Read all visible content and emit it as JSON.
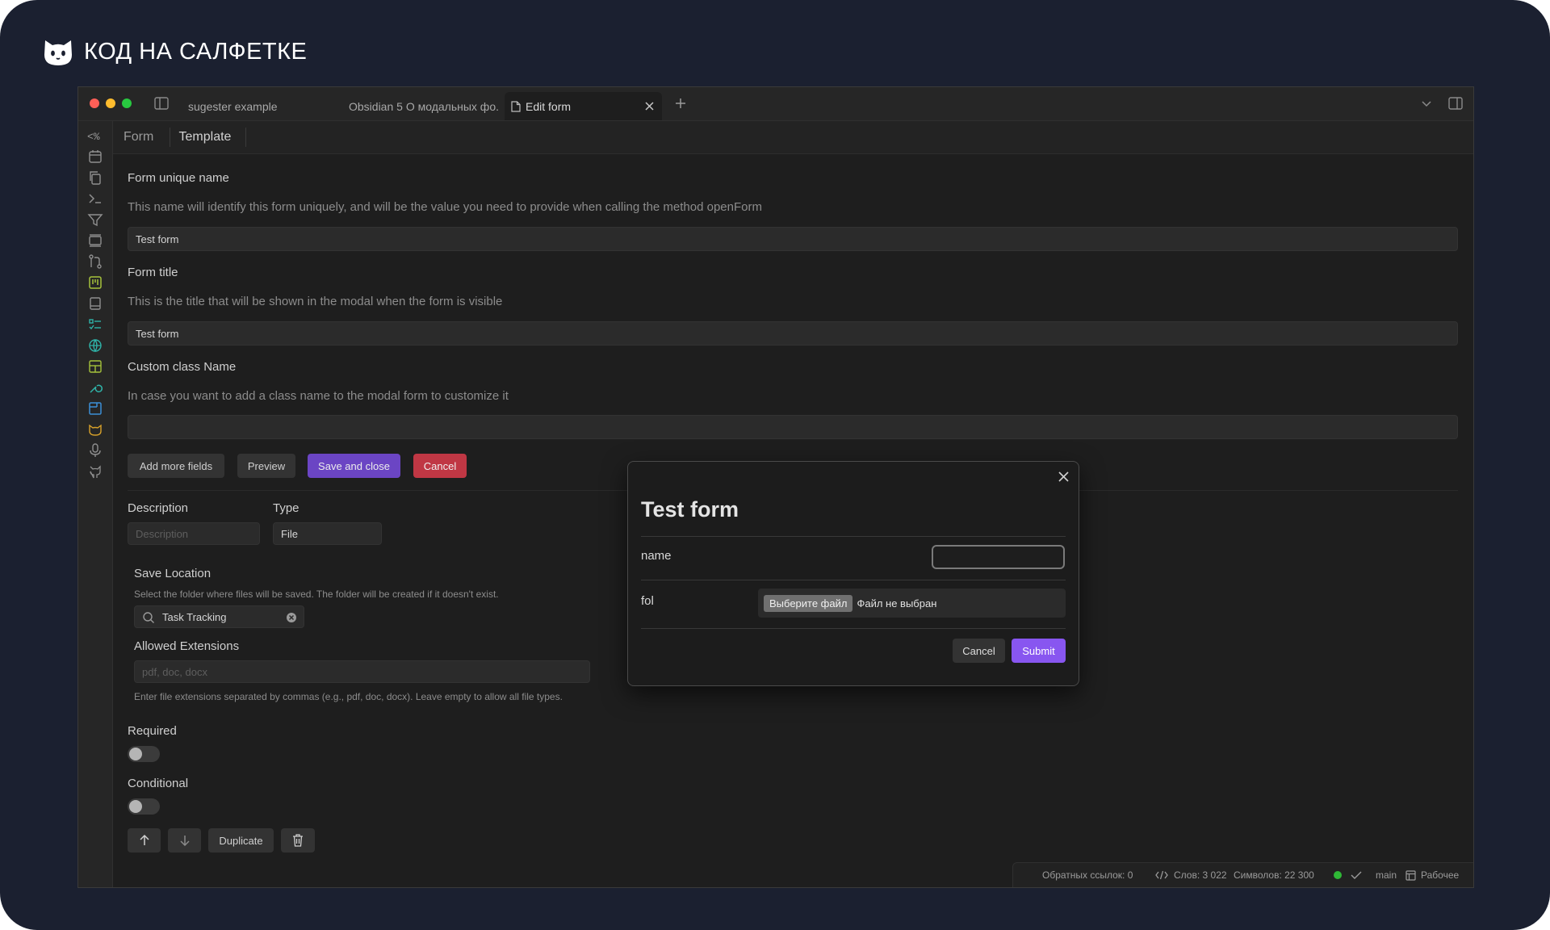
{
  "brand": {
    "title": "КОД НА САЛФЕТКЕ",
    "logo_icon": "cat-icon"
  },
  "tabs": [
    {
      "label": "sugester example"
    },
    {
      "label": "Obsidian 5 О модальных фо..."
    },
    {
      "label": "Edit form"
    }
  ],
  "subtabs": {
    "form": "Form",
    "template": "Template"
  },
  "form": {
    "unique_name_label": "Form unique name",
    "unique_name_desc": "This name will identify this form uniquely, and will be the value you need to provide when calling the method openForm",
    "unique_name_value": "Test form",
    "title_label": "Form title",
    "title_desc": "This is the title that will be shown in the modal when the form is visible",
    "title_value": "Test form",
    "class_label": "Custom class Name",
    "class_desc": "In case you want to add a class name to the modal form to customize it",
    "class_value": ""
  },
  "buttons": {
    "add_more": "Add more fields",
    "preview": "Preview",
    "save_close": "Save and close",
    "cancel": "Cancel"
  },
  "field": {
    "description_label": "Description",
    "description_placeholder": "Description",
    "type_label": "Type",
    "type_value": "File",
    "save_location_label": "Save Location",
    "save_location_desc": "Select the folder where files will be saved. The folder will be created if it doesn't exist.",
    "save_location_value": "Task Tracking",
    "allowed_ext_label": "Allowed Extensions",
    "allowed_ext_placeholder": "pdf, doc, docx",
    "allowed_ext_desc": "Enter file extensions separated by commas (e.g., pdf, doc, docx). Leave empty to allow all file types.",
    "required_label": "Required",
    "required_on": false,
    "conditional_label": "Conditional",
    "conditional_on": false,
    "duplicate_label": "Duplicate"
  },
  "status": {
    "backlinks": "Обратных ссылок: 0",
    "words": "Слов: 3 022",
    "chars": "Символов: 22 300",
    "branch": "main",
    "workspace": "Рабочее"
  },
  "modal": {
    "title": "Test form",
    "name_label": "name",
    "name_value": "",
    "fol_label": "fol",
    "file_button": "Выберите файл",
    "file_status": "Файл не выбран",
    "cancel": "Cancel",
    "submit": "Submit"
  },
  "colors": {
    "accent": "#7c4ddc",
    "danger": "#c03744",
    "submit": "#8856f0"
  }
}
